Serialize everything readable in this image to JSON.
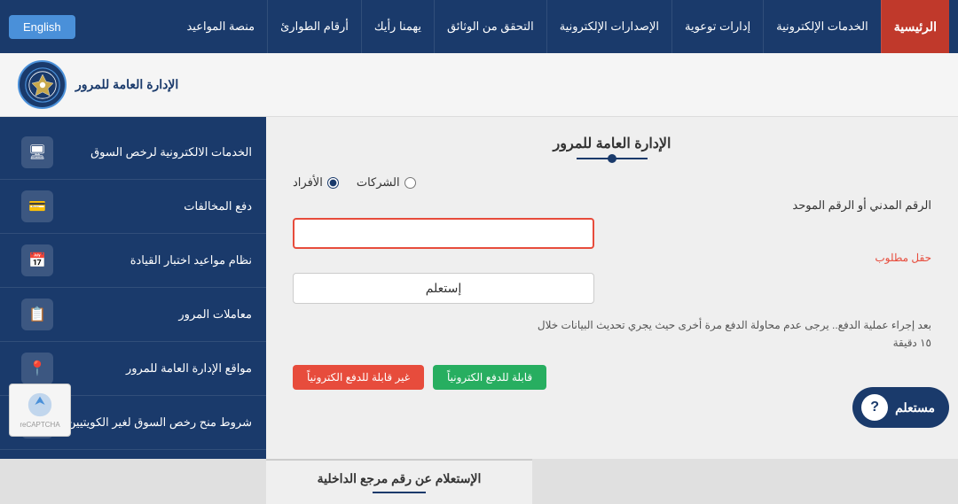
{
  "topnav": {
    "items": [
      {
        "label": "الرئيسية",
        "key": "home"
      },
      {
        "label": "الخدمات الإلكترونية",
        "key": "eservices"
      },
      {
        "label": "إدارات توعوية",
        "key": "awareness"
      },
      {
        "label": "الإصدارات الإلكترونية",
        "key": "publications"
      },
      {
        "label": "التحقق من الوثائق",
        "key": "verify"
      },
      {
        "label": "يهمنا رأيك",
        "key": "feedback"
      },
      {
        "label": "أرقام الطوارئ",
        "key": "emergency"
      },
      {
        "label": "منصة المواعيد",
        "key": "appointments"
      }
    ],
    "english_btn": "English"
  },
  "header": {
    "logo_text": "الإدارة العامة للمرور"
  },
  "form": {
    "title": "الإدارة العامة للمرور",
    "radio_individuals": "الأفراد",
    "radio_companies": "الشركات",
    "field_label": "الرقم المدني أو الرقم الموحد",
    "required_text": "حقل مطلوب",
    "submit_label": "إستعلم",
    "info_text": "بعد إجراء عملية الدفع.. يرجى عدم محاولة الدفع مرة أخرى حيث يجري تحديث البيانات خلال ١٥ دقيقة",
    "btn_green": "قابلة للدفع الكترونياً",
    "btn_red": "غير قابلة للدفع الكترونياً"
  },
  "sidebar": {
    "items": [
      {
        "label": "الخدمات الالكترونية لرخص السوق",
        "icon": "🖥"
      },
      {
        "label": "دفع المخالفات",
        "icon": "💳"
      },
      {
        "label": "نظام مواعيد اختبار القيادة",
        "icon": "📅"
      },
      {
        "label": "معاملات المرور",
        "icon": "📋"
      },
      {
        "label": "مواقع الإدارة العامة للمرور",
        "icon": "📍"
      },
      {
        "label": "شروط منح رخص السوق لغير الكويتيين",
        "icon": "📄"
      }
    ]
  },
  "bottom": {
    "inquiry_title": "الإستعلام عن رقم مرجع الداخلية"
  },
  "mustalam": {
    "label": "مستعلم"
  }
}
